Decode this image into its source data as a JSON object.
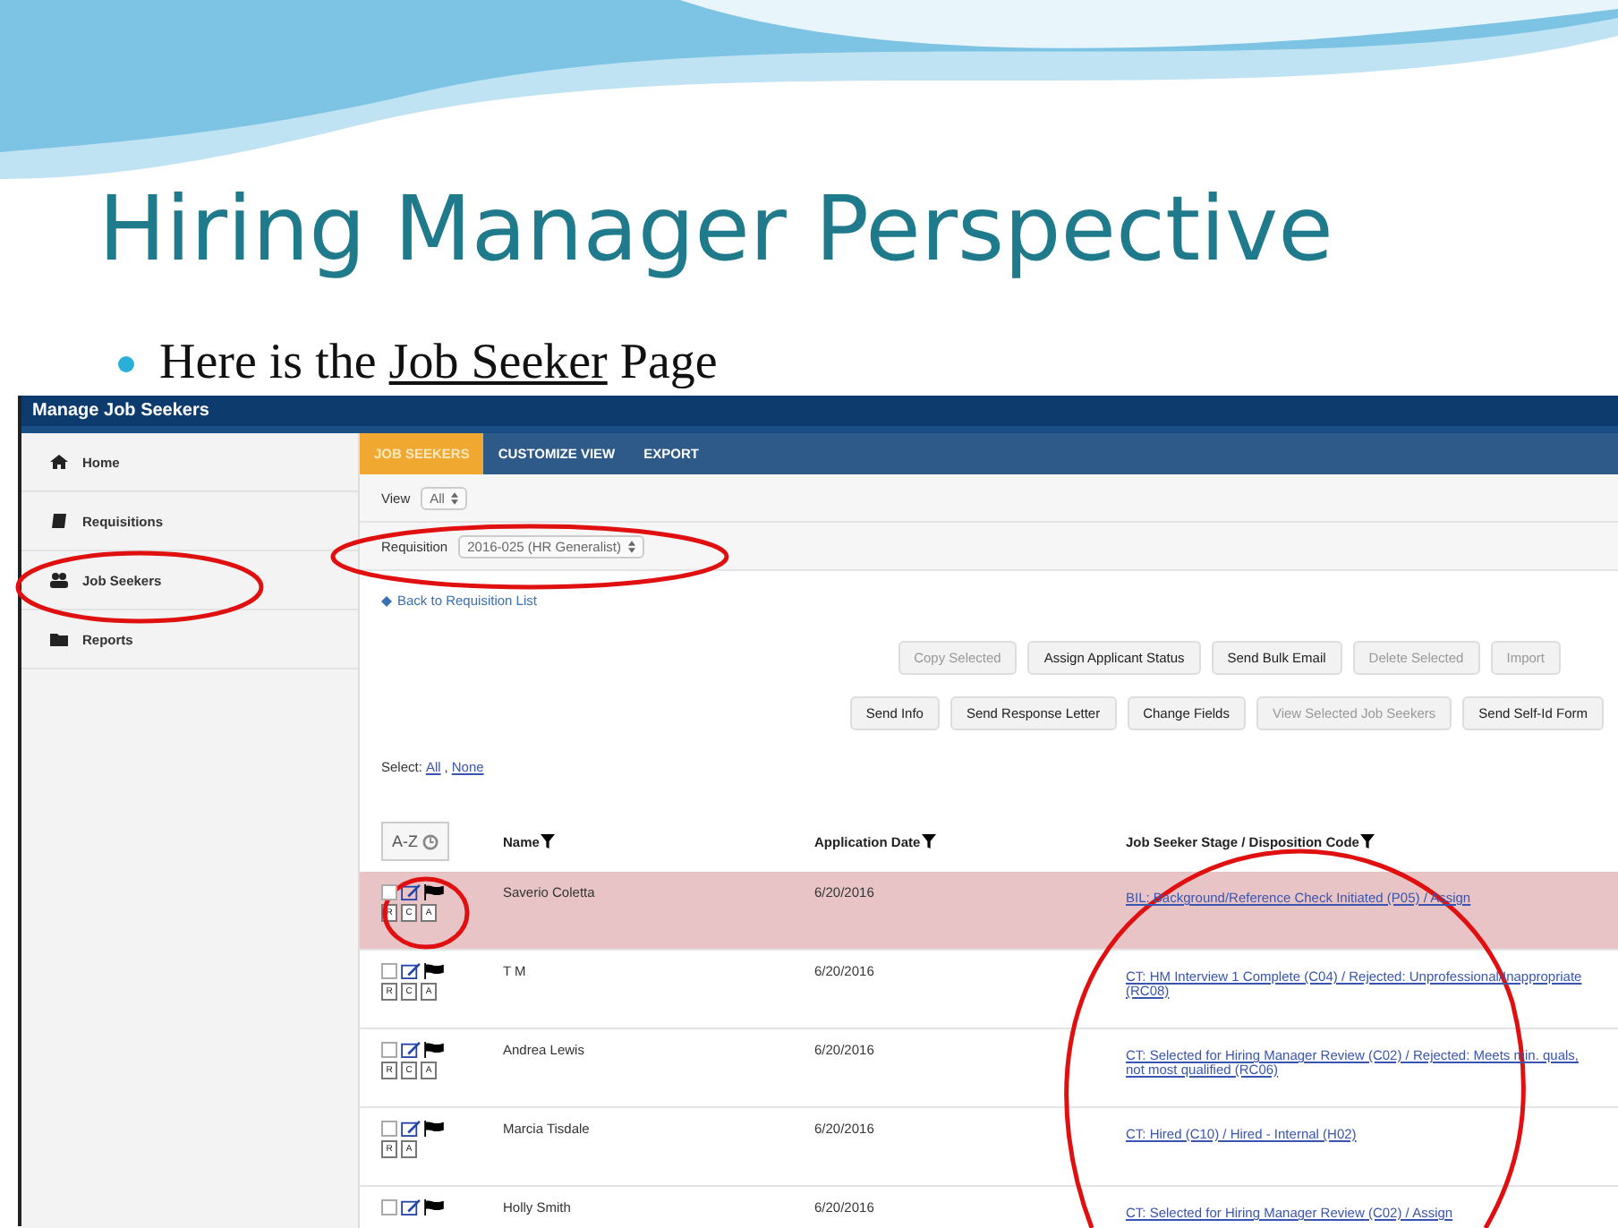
{
  "slide": {
    "title": "Hiring Manager Perspective",
    "bullet": {
      "before": "Here is the ",
      "underlined": "Job Seeker",
      "after": " Page"
    }
  },
  "app": {
    "title": "Manage Job Seekers",
    "sidebar": [
      {
        "label": "Home"
      },
      {
        "label": "Requisitions"
      },
      {
        "label": "Job Seekers"
      },
      {
        "label": "Reports"
      }
    ],
    "tabs": [
      {
        "label": "JOB SEEKERS",
        "selected": true
      },
      {
        "label": "CUSTOMIZE VIEW",
        "selected": false
      },
      {
        "label": "EXPORT",
        "selected": false
      }
    ],
    "view": {
      "label": "View",
      "value": "All"
    },
    "requisition": {
      "label": "Requisition",
      "value": "2016-025 (HR Generalist)"
    },
    "back_link": "Back to Requisition List",
    "button_rows": [
      [
        {
          "label": "Copy Selected",
          "disabled": true
        },
        {
          "label": "Assign Applicant Status",
          "disabled": false
        },
        {
          "label": "Send Bulk Email",
          "disabled": false
        },
        {
          "label": "Delete Selected",
          "disabled": true
        },
        {
          "label": "Import",
          "disabled": true
        }
      ],
      [
        {
          "label": "Send Info",
          "disabled": false
        },
        {
          "label": "Send Response Letter",
          "disabled": false
        },
        {
          "label": "Change Fields",
          "disabled": false
        },
        {
          "label": "View Selected Job Seekers",
          "disabled": true
        },
        {
          "label": "Send Self-Id Form",
          "disabled": false
        }
      ]
    ],
    "select": {
      "label": "Select:",
      "all": "All",
      "sep": ",",
      "none": "None"
    },
    "sort_button": "A-Z",
    "columns": [
      "Name",
      "Application Date",
      "Job Seeker Stage / Disposition Code"
    ],
    "rows": [
      {
        "checked": false,
        "highlighted": true,
        "docs": [
          "R",
          "C",
          "A"
        ],
        "name": "Saverio Coletta",
        "date": "6/20/2016",
        "stage": "BIL: Background/Reference Check Initiated (P05) / Assign"
      },
      {
        "checked": false,
        "highlighted": false,
        "docs": [
          "R",
          "C",
          "A"
        ],
        "name": "T M",
        "date": "6/20/2016",
        "stage": "CT: HM Interview 1 Complete (C04) / Rejected: Unprofessional/Inappropriate (RC08)"
      },
      {
        "checked": false,
        "highlighted": false,
        "docs": [
          "R",
          "C",
          "A"
        ],
        "name": "Andrea Lewis",
        "date": "6/20/2016",
        "stage": "CT: Selected for Hiring Manager Review (C02) / Rejected: Meets min. quals, not most qualified (RC06)"
      },
      {
        "checked": false,
        "highlighted": false,
        "docs": [
          "R",
          "A"
        ],
        "name": "Marcia Tisdale",
        "date": "6/20/2016",
        "stage": "CT: Hired (C10) / Hired - Internal (H02)"
      },
      {
        "checked": false,
        "highlighted": false,
        "docs": [],
        "name": "Holly Smith",
        "date": "6/20/2016",
        "stage": "CT: Selected for Hiring Manager Review (C02) / Assign"
      }
    ]
  }
}
